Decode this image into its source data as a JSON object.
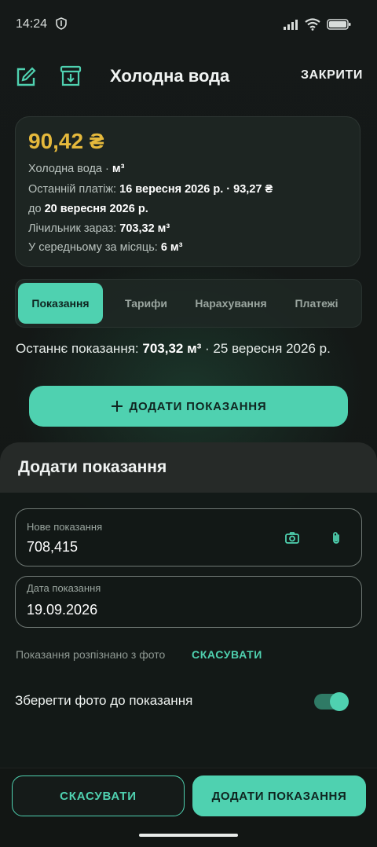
{
  "status": {
    "time": "14:24",
    "left_icon": "shield-icon",
    "right_icons": [
      "signal-icon",
      "wifi-icon",
      "battery-icon"
    ]
  },
  "app_bar": {
    "title": "Холодна вода",
    "close_label": "ЗАКРИТИ",
    "icons": [
      "edit-icon",
      "archive-icon"
    ]
  },
  "summary": {
    "amount": "90,42 ₴",
    "service_name": "Холодна вода · ",
    "service_unit": "м³",
    "last_payment_label": "Останній платіж: ",
    "last_payment_value": "16 вересня 2026 р. · 93,27 ₴",
    "due_prefix": "до ",
    "due_value": "20 вересня 2026 р.",
    "meter_label": "Лічильник зараз: ",
    "meter_value": "703,32 м³",
    "avg_label": "У середньому за місяць: ",
    "avg_value": "6 м³"
  },
  "tabs": [
    {
      "label": "Показання",
      "active": true
    },
    {
      "label": "Тарифи",
      "active": false
    },
    {
      "label": "Нарахування",
      "active": false
    },
    {
      "label": "Платежі",
      "active": false
    }
  ],
  "last_reading": {
    "prefix": "Останнє показання: ",
    "value": "703,32 м³",
    "suffix": " · 25 вересня 2026 р."
  },
  "add_reading_button": "ДОДАТИ ПОКАЗАННЯ",
  "sheet": {
    "title": "Додати показання",
    "new_reading": {
      "label": "Нове показання",
      "value": "708,415"
    },
    "reading_date": {
      "label": "Дата показання",
      "value": "19.09.2026"
    },
    "recognized_text": "Показання розпізнано з фото",
    "recognized_cancel": "СКАСУВАТИ",
    "save_photo_label": "Зберегти фото до показання",
    "save_photo_enabled": true,
    "accent_color": "#4fd1b0"
  },
  "footer": {
    "cancel_label": "СКАСУВАТИ",
    "add_label": "ДОДАТИ ПОКАЗАННЯ"
  }
}
